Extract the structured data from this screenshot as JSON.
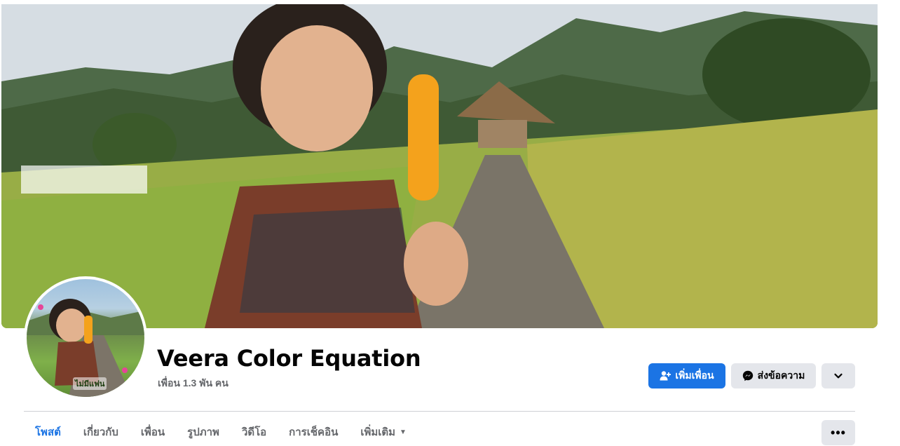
{
  "profile": {
    "name": "Veera Color Equation",
    "friends_count": "เพื่อน 1.3 พัน คน",
    "avatar_caption": "ไม่มีแฟน"
  },
  "actions": {
    "add_friend_label": "เพิ่มเพื่อน",
    "message_label": "ส่งข้อความ"
  },
  "tabs": [
    {
      "label": "โพสต์",
      "active": true
    },
    {
      "label": "เกี่ยวกับ",
      "active": false
    },
    {
      "label": "เพื่อน",
      "active": false
    },
    {
      "label": "รูปภาพ",
      "active": false
    },
    {
      "label": "วิดีโอ",
      "active": false
    },
    {
      "label": "การเช็คอิน",
      "active": false
    },
    {
      "label": "เพิ่มเติม",
      "active": false
    }
  ],
  "icons": {
    "add_friend": "person-plus-icon",
    "message": "messenger-icon",
    "more_actions": "chevron-down-icon",
    "more_tab": "caret-down-icon",
    "overflow": "ellipsis-icon"
  },
  "colors": {
    "accent": "#1b74e4",
    "secondary_button": "#e4e6eb",
    "muted_text": "#65676b"
  }
}
